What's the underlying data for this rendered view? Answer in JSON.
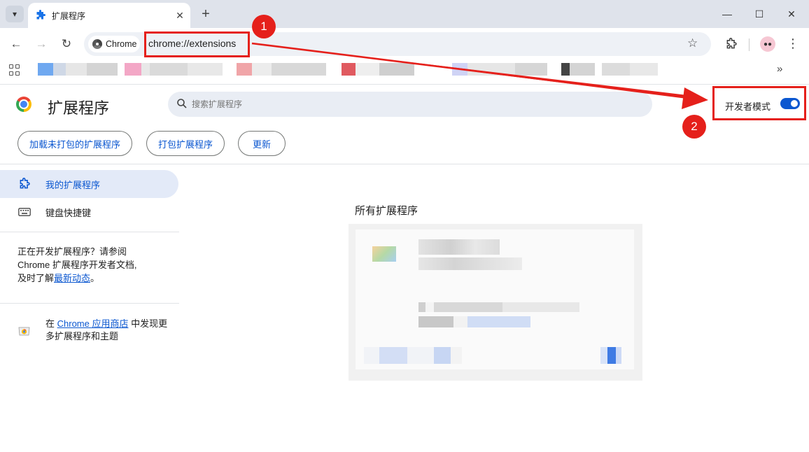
{
  "browser": {
    "tab_title": "扩展程序",
    "chip_label": "Chrome",
    "url": "chrome://extensions"
  },
  "page": {
    "title": "扩展程序",
    "search_placeholder": "搜索扩展程序",
    "developer_mode_label": "开发者模式",
    "developer_mode_enabled": true
  },
  "actions": {
    "load_unpacked": "加载未打包的扩展程序",
    "pack": "打包扩展程序",
    "update": "更新"
  },
  "sidebar": {
    "my_extensions": "我的扩展程序",
    "shortcuts": "键盘快捷键",
    "dev_text_1": "正在开发扩展程序？请参阅",
    "dev_text_2": "Chrome 扩展程序开发者文档,",
    "dev_text_3": "及时了解",
    "dev_link": "最新动态",
    "dev_text_end": "。",
    "store_prefix": "在 ",
    "store_link": "Chrome 应用商店",
    "store_suffix": " 中发现更多扩展程序和主题"
  },
  "main": {
    "section_title": "所有扩展程序"
  },
  "annotations": {
    "step1": "1",
    "step2": "2",
    "color": "#e5201b"
  },
  "colors": {
    "accent": "#0b57d0",
    "active_bg": "#e3eaf8"
  }
}
